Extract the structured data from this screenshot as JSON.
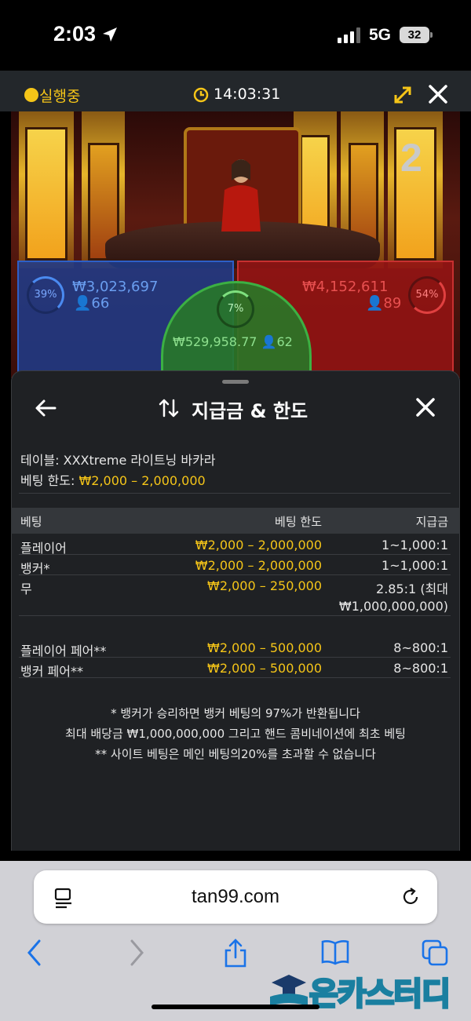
{
  "status_bar": {
    "time": "2:03",
    "network": "5G",
    "battery": "32"
  },
  "game_header": {
    "status": "실행중",
    "clock": "14:03:31"
  },
  "video": {
    "round_number": "2",
    "player": {
      "percent": "39%",
      "amount": "₩3,023,697",
      "players": "66"
    },
    "banker": {
      "percent": "54%",
      "amount": "₩4,152,611",
      "players": "89"
    },
    "tie": {
      "percent": "7%",
      "amount": "₩529,958.77",
      "players": "62"
    }
  },
  "sheet": {
    "title": "지급금 & 한도",
    "table_info_label": "테이블: XXXtreme 라이트닝 바카라",
    "limit_label": "베팅 한도: ",
    "limit_value": "₩2,000 – 2,000,000",
    "columns": {
      "bet": "베팅",
      "limit": "베팅 한도",
      "payout": "지급금"
    },
    "rows": [
      {
        "name": "플레이어",
        "limit": "₩2,000 – 2,000,000",
        "payout": "1~1,000:1"
      },
      {
        "name": "뱅커*",
        "limit": "₩2,000 – 2,000,000",
        "payout": "1~1,000:1"
      },
      {
        "name": "무",
        "limit": "₩2,000 – 250,000",
        "payout": "2.85:1 (최대",
        "payout2": "₩1,000,000,000)"
      },
      {
        "name": "플레이어 페어**",
        "limit": "₩2,000 – 500,000",
        "payout": "8~800:1"
      },
      {
        "name": "뱅커 페어**",
        "limit": "₩2,000 – 500,000",
        "payout": "8~800:1"
      }
    ],
    "notes": [
      "* 뱅커가 승리하면 뱅커 베팅의 97%가 반환됩니다",
      "최대 배당금 ₩1,000,000,000 그리고 핸드 콤비네이션에 최초 베팅",
      "** 사이트 베팅은 메인 베팅의20%를 초과할 수 없습니다"
    ]
  },
  "browser": {
    "url": "tan99.com"
  },
  "watermark": {
    "text": "온카스터디"
  },
  "icons": {
    "location": "location-arrow-icon",
    "expand": "expand-icon",
    "close": "close-icon",
    "back": "back-arrow-icon",
    "sort": "sort-arrows-icon",
    "reader": "reader-icon",
    "reload": "reload-icon",
    "nav_back": "chevron-left-icon",
    "nav_forward": "chevron-right-icon",
    "share": "share-icon",
    "bookmarks": "book-icon",
    "tabs": "tabs-icon"
  },
  "colors": {
    "accent": "#f5c518",
    "player": "#2d5fc7",
    "banker": "#c73030",
    "tie": "#3cb043",
    "sheet_bg": "#1f2124"
  }
}
